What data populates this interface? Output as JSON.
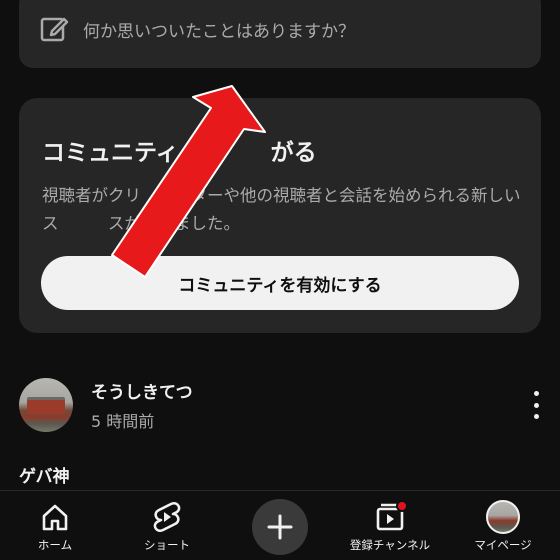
{
  "composer": {
    "placeholder": "何か思いついたことはありますか？",
    "icon": "edit-icon"
  },
  "community_card": {
    "title": "コミュニティ　　　　がる",
    "description": "視聴者がクリ　　　ターや他の視聴者と会話を始められる新しいス　　　スができました。",
    "button_label": "コミュニティを有効にする"
  },
  "post": {
    "author": "そうしきてつ",
    "time": "5 時間前",
    "body": "ゲバ神",
    "menu_icon": "more-vert-icon"
  },
  "nav": {
    "items": [
      {
        "label": "ホーム",
        "icon": "home-icon"
      },
      {
        "label": "ショート",
        "icon": "shorts-icon"
      },
      {
        "label": "",
        "icon": "create-icon"
      },
      {
        "label": "登録チャンネル",
        "icon": "subscriptions-icon"
      },
      {
        "label": "マイページ",
        "icon": "avatar"
      }
    ]
  },
  "overlay": {
    "arrow_color": "#e8191a",
    "arrow_outline": "#ffffff"
  }
}
